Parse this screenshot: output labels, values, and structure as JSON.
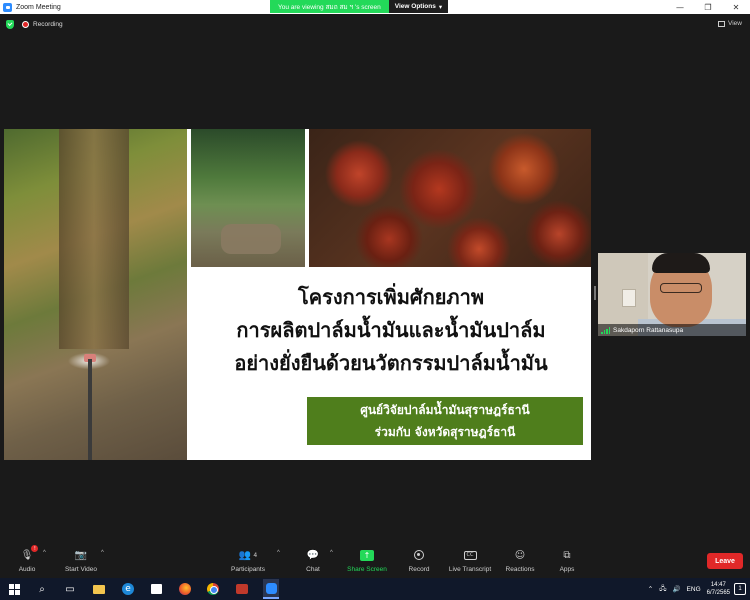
{
  "window": {
    "title": "Zoom Meeting",
    "controls": {
      "minimize": "—",
      "restore": "❐",
      "close": "✕"
    }
  },
  "share_banner": {
    "viewing_text": "You are viewing สมถ สม ฯ 's screen",
    "view_options_label": "View Options",
    "view_options_caret": "▾"
  },
  "meeting_status": {
    "recording_label": "Recording",
    "view_label": "View"
  },
  "slide": {
    "title_line1": "โครงการเพิ่มศักยภาพ",
    "title_line2": "การผลิตปาล์มน้ำมันและน้ำมันปาล์ม",
    "title_line3": "อย่างยั่งยืนด้วยนวัตกรรมปาล์มน้ำมัน",
    "org_line1": "ศูนย์วิจัยปาล์มน้ำมันสุราษฎร์ธานี",
    "org_line2": "ร่วมกับ จังหวัดสุราษฎร์ธานี"
  },
  "participant": {
    "name": "Sakdaporn Rattanasupa"
  },
  "toolbar": {
    "audio_label": "Audio",
    "audio_badge": "!",
    "video_label": "Start Video",
    "participants_label": "Participants",
    "participants_count": "4",
    "chat_label": "Chat",
    "share_label": "Share Screen",
    "record_label": "Record",
    "transcript_label": "Live Transcript",
    "transcript_icon_text": "CC",
    "reactions_label": "Reactions",
    "apps_label": "Apps",
    "leave_label": "Leave",
    "caret": "^"
  },
  "taskbar": {
    "language": "ENG",
    "time": "14:47",
    "date": "6/7/2565",
    "notification_count": "1"
  },
  "colors": {
    "zoom_green": "#23d959",
    "leave_red": "#e02828",
    "slide_green_box": "#4f7e1c",
    "taskbar_bg": "#10182a"
  }
}
